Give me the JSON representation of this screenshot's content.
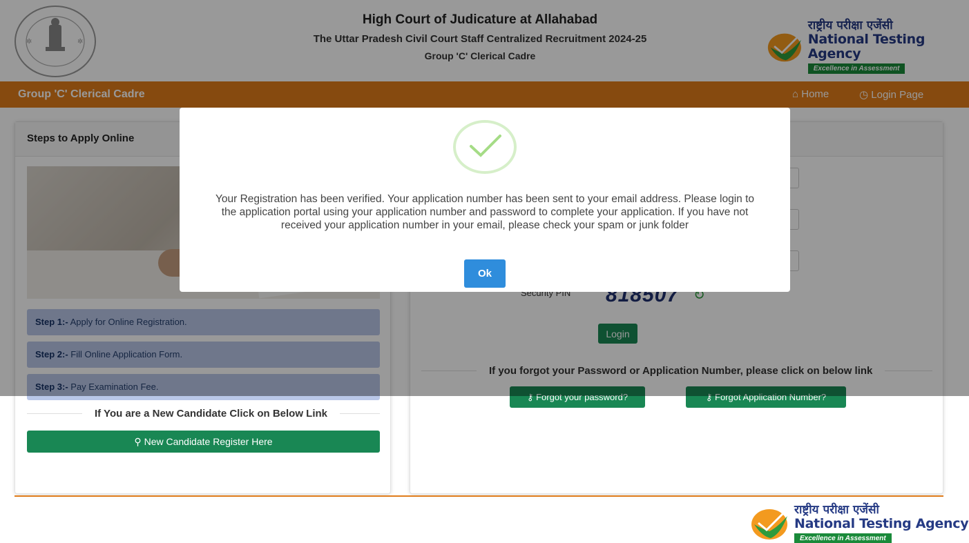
{
  "header": {
    "seal_text_top": "HIGH COURT",
    "seal_text_bottom": "AT ALLAHABAD",
    "title": "High Court of Judicature at Allahabad",
    "subtitle": "The Uttar Pradesh Civil Court Staff Centralized Recruitment 2024-25",
    "cadre": "Group 'C' Clerical Cadre",
    "nta_hindi": "राष्ट्रीय परीक्षा एजेंसी",
    "nta_english": "National Testing Agency",
    "nta_tagline": "Excellence in Assessment"
  },
  "navbar": {
    "title": "Group 'C' Clerical Cadre",
    "home_label": "Home",
    "login_label": "Login Page",
    "home_icon": "⌂",
    "login_icon": "◷"
  },
  "left_panel": {
    "heading": "Steps to Apply Online",
    "steps": [
      {
        "prefix": "Step 1:-",
        "text": " Apply for Online Registration."
      },
      {
        "prefix": "Step 2:-",
        "text": " Fill Online Application Form."
      },
      {
        "prefix": "Step 3:-",
        "text": " Pay Examination Fee."
      }
    ],
    "new_candidate_text": "If You are a New Candidate Click on Below Link",
    "register_button": "New Candidate Register Here",
    "register_icon": "⚲"
  },
  "right_panel": {
    "security_pin_label": "Security PIN",
    "captcha_value": "818507",
    "refresh_icon": "↻",
    "login_button": "Login",
    "forgot_text": "If you forgot your Password or Application Number, please click on below link",
    "forgot_password_button": "Forgot your password?",
    "forgot_appno_button": "Forgot Application Number?",
    "key_icon": "⚷"
  },
  "modal": {
    "message": "Your Registration has been verified. Your application number has been sent to your email address. Please login to the application portal using your application number and password to complete your application. If you have not received your application number in your email, please check your spam or junk folder",
    "ok_button": "Ok"
  },
  "colors": {
    "nav_orange": "#e07c1a",
    "button_green": "#198754",
    "ok_blue": "#2f8ddc",
    "step_blue": "#b9c7e8"
  }
}
